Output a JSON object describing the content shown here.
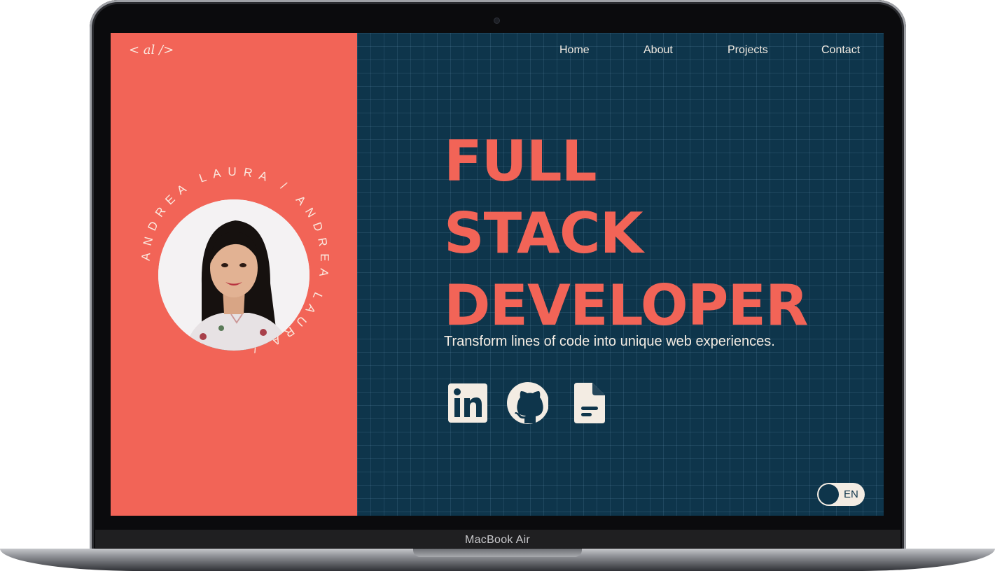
{
  "device": {
    "model_label": "MacBook Air"
  },
  "site": {
    "logo": "< al />",
    "nav": [
      {
        "label": "Home"
      },
      {
        "label": "About"
      },
      {
        "label": "Projects"
      },
      {
        "label": "Contact"
      }
    ],
    "profile": {
      "ring_text": "ANDREA  LAURA  /  ANDREA  LAURA  /"
    },
    "hero": {
      "title_lines": [
        "FULL",
        "STACK",
        "DEVELOPER"
      ],
      "tagline": "Transform lines of code into unique web experiences."
    },
    "social": [
      {
        "icon": "linkedin-icon"
      },
      {
        "icon": "github-icon"
      },
      {
        "icon": "document-icon"
      }
    ],
    "language_toggle": {
      "label": "EN"
    }
  },
  "colors": {
    "accent": "#f26457",
    "panel_dark": "#0e354b",
    "cream": "#f3ece3"
  }
}
